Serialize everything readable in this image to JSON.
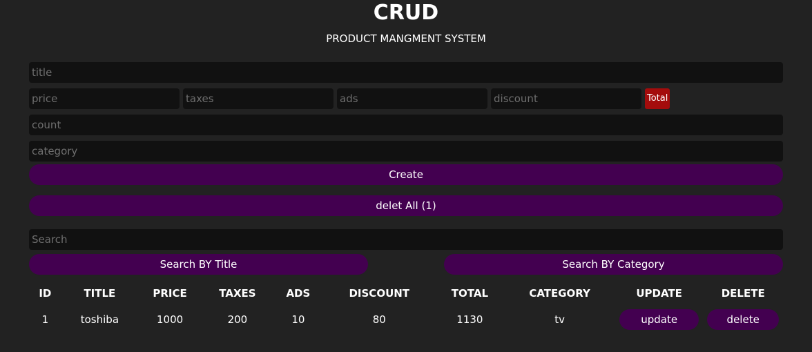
{
  "header": {
    "title": "CRUD",
    "subtitle": "PRODUCT MANGMENT SYSTEM"
  },
  "form": {
    "title_placeholder": "title",
    "price_placeholder": "price",
    "taxes_placeholder": "taxes",
    "ads_placeholder": "ads",
    "discount_placeholder": "discount",
    "total_label": "Total",
    "count_placeholder": "count",
    "category_placeholder": "category",
    "create_label": "Create",
    "delete_all_label": "delet All (1)"
  },
  "search": {
    "placeholder": "Search",
    "by_title_label": "Search BY Title",
    "by_category_label": "Search BY Category"
  },
  "table": {
    "columns": [
      "ID",
      "TITLE",
      "PRICE",
      "TAXES",
      "ADS",
      "DISCOUNT",
      "TOTAL",
      "CATEGORY",
      "UPDATE",
      "DELETE"
    ],
    "rows": [
      {
        "id": "1",
        "title": "toshiba",
        "price": "1000",
        "taxes": "200",
        "ads": "10",
        "discount": "80",
        "total": "1130",
        "category": "tv",
        "update": "update",
        "delete": "delete"
      }
    ]
  },
  "colors": {
    "background": "#222222",
    "input_bg": "#111111",
    "button": "#430050",
    "total_bg": "#a40c0c"
  }
}
